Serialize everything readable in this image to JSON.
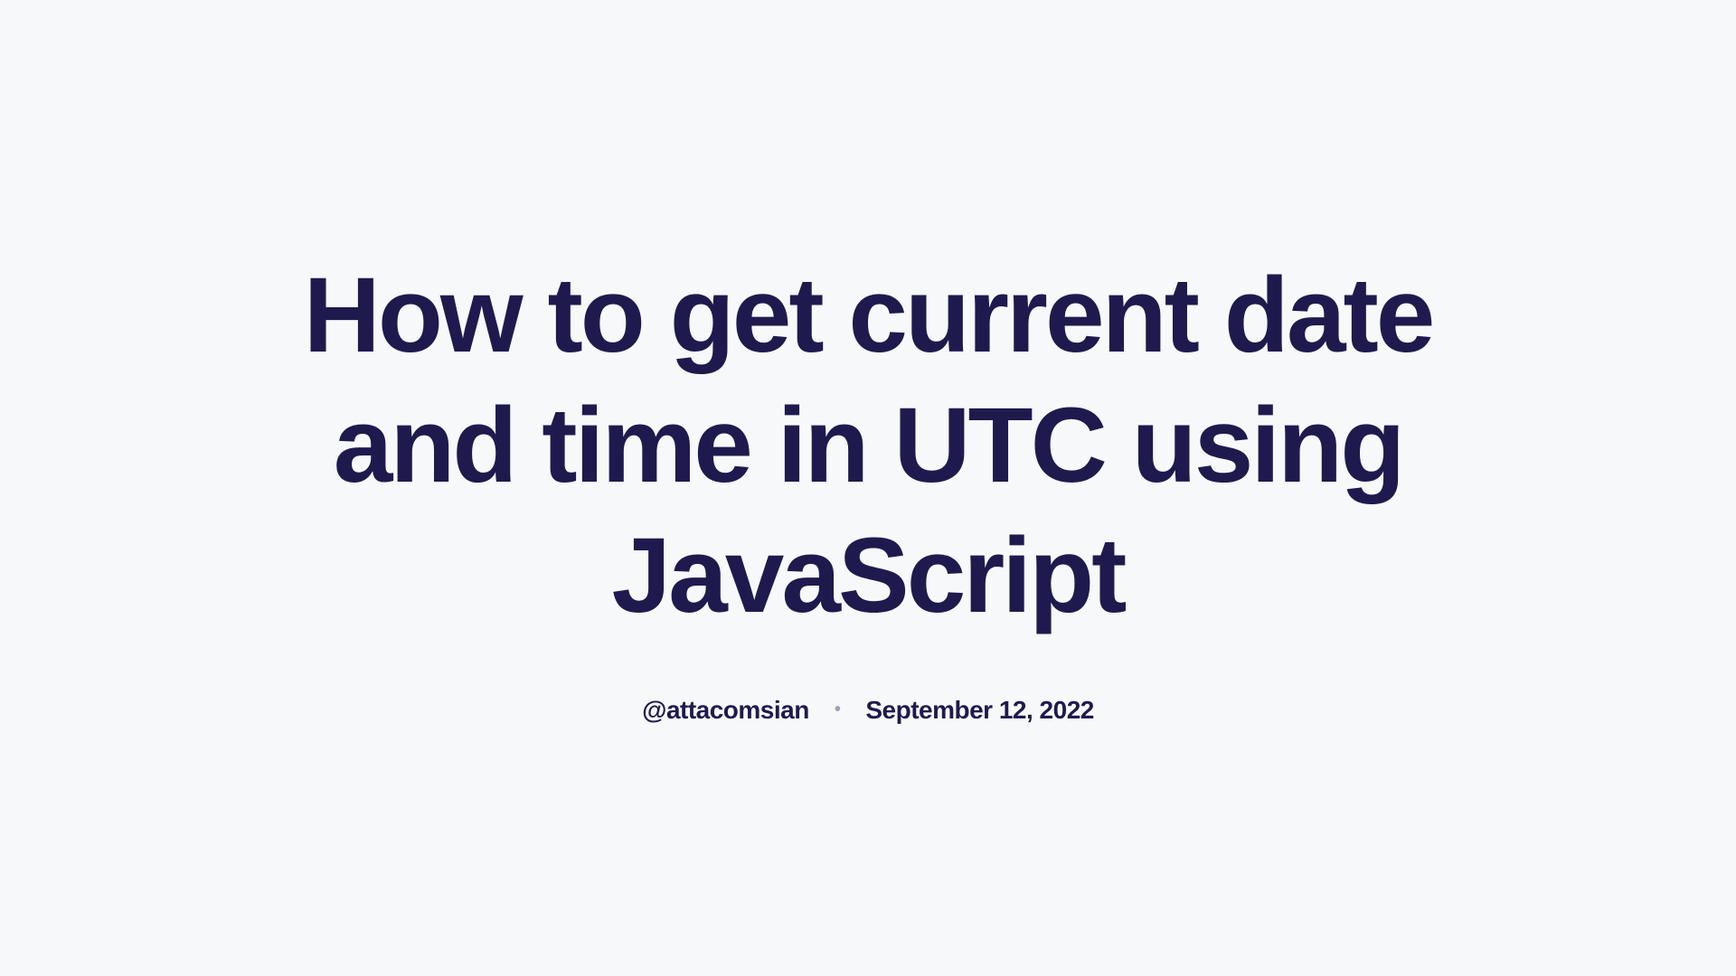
{
  "article": {
    "title": "How to get current date and time in UTC using JavaScript",
    "author": "@attacomsian",
    "date": "September 12, 2022"
  }
}
